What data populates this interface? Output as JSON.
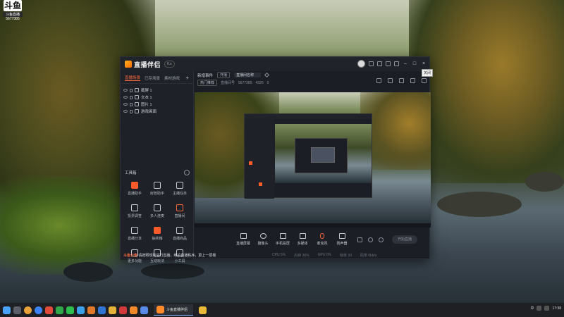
{
  "desktop": {
    "icon_glyph": "斗鱼",
    "icon_label": "斗鱼直播",
    "icon_id": "5677385"
  },
  "app": {
    "name": "直播伴侣",
    "version": "6.x",
    "tooltip_close": "关闭",
    "brand_color": "#ff6a3d"
  },
  "scene_tabs": [
    "直播场景",
    "已存场景",
    "素材游戏"
  ],
  "sources": [
    "截屏 1",
    "文本 1",
    "图片 1",
    "游戏画面"
  ],
  "toolbox": {
    "title": "工具箱",
    "tools": [
      {
        "label": "直播助手",
        "icon": "live-assist-icon",
        "hot": true
      },
      {
        "label": "房管助手",
        "icon": "manager-icon"
      },
      {
        "label": "主播任务",
        "icon": "task-icon"
      },
      {
        "label": "投票调查",
        "icon": "vote-icon"
      },
      {
        "label": "多人连麦",
        "icon": "multi-mic-icon"
      },
      {
        "label": "直播间",
        "icon": "room-icon",
        "hot2": true
      },
      {
        "label": "直播分享",
        "icon": "share-icon"
      },
      {
        "label": "抽奖箱",
        "icon": "lottery-icon",
        "hot": true
      },
      {
        "label": "直播商品",
        "icon": "goods-icon"
      },
      {
        "label": "更多功能",
        "icon": "more-icon"
      },
      {
        "label": "互动玩法",
        "icon": "interactive-icon"
      },
      {
        "label": "小工具",
        "icon": "widget-icon"
      }
    ],
    "notice_prefix": "斗鱼公告",
    "notice_text": "请按照规则进行直播，维护直播秩序，更上一层楼"
  },
  "infobar": {
    "title": "新增事件",
    "room_name": "直播间名称",
    "category": "热门推荐",
    "sub_tag": "开播",
    "room_label": "直播间号",
    "room_id": "5677385",
    "fans": "4326",
    "online": "0"
  },
  "controls": [
    {
      "label": "直播屏幕",
      "icon": "screen-icon"
    },
    {
      "label": "摄像头",
      "icon": "camera-icon"
    },
    {
      "label": "手机投屏",
      "icon": "phone-cast-icon"
    },
    {
      "label": "多媒体",
      "icon": "media-icon"
    },
    {
      "label": "麦克风",
      "icon": "mic-icon"
    },
    {
      "label": "扬声器",
      "icon": "speaker-icon"
    }
  ],
  "live_button": "开始直播",
  "footer": [
    "CPU 5%",
    "内存 36%",
    "GPU 0%",
    "帧率 30",
    "码率 0kb/s"
  ],
  "taskbar": {
    "active_label": "斗鱼直播伴侣",
    "tray_lang": "中",
    "tray_time": "17:38"
  }
}
